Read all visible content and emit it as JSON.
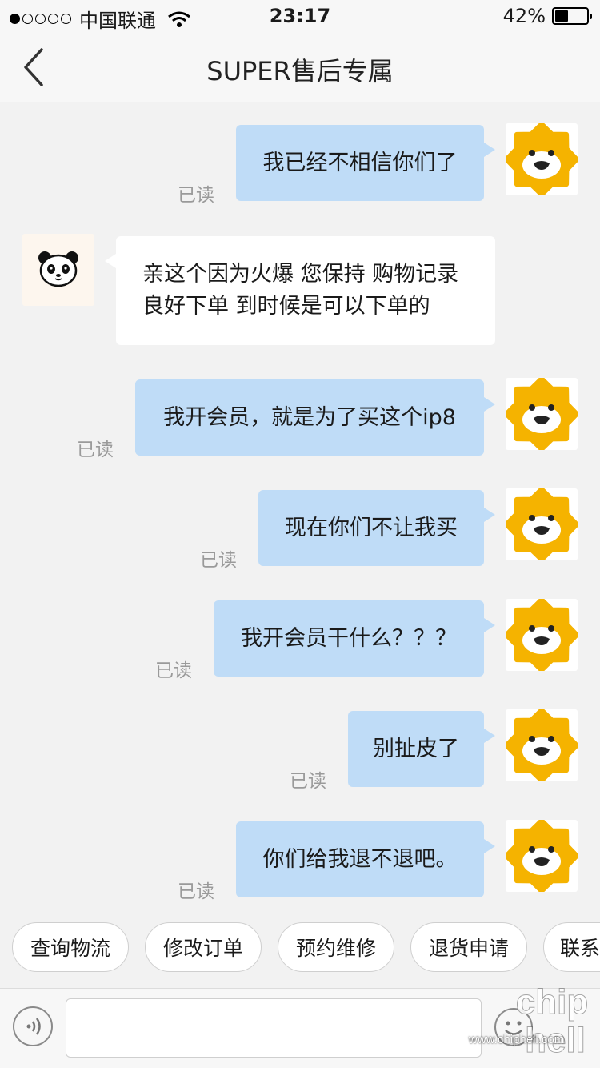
{
  "status_bar": {
    "carrier": "中国联通",
    "time": "23:17",
    "battery_percent": "42%",
    "battery_level": 0.42,
    "signal_dots_filled": 1,
    "signal_dots_total": 5
  },
  "nav": {
    "title": "SUPER售后专属",
    "back_icon": "chevron-left-icon"
  },
  "read_label": "已读",
  "messages": [
    {
      "direction": "out",
      "text": "我已经不相信你们了",
      "read": "已读"
    },
    {
      "direction": "in",
      "lines": [
        "亲这个因为火爆  您保持 购物记录",
        "良好下单 到时候是可以下单的"
      ]
    },
    {
      "direction": "out",
      "text": "我开会员，就是为了买这个ip8",
      "read": "已读"
    },
    {
      "direction": "out",
      "text": "现在你们不让我买",
      "read": "已读"
    },
    {
      "direction": "out",
      "text": "我开会员干什么？？？",
      "read": "已读"
    },
    {
      "direction": "out",
      "text": "别扯皮了",
      "read": "已读"
    },
    {
      "direction": "out",
      "text": "你们给我退不退吧。",
      "read": "已读"
    }
  ],
  "quick_replies": [
    "查询物流",
    "修改订单",
    "预约维修",
    "退货申请",
    "联系"
  ],
  "input_bar": {
    "voice_icon": "voice-icon",
    "emoji_icon": "emoji-icon",
    "input_value": ""
  },
  "watermark": {
    "logo_text": "chip hell",
    "url": "www.chiphell.com"
  },
  "colors": {
    "out_bubble": "#bfdcf7",
    "in_bubble": "#ffffff",
    "background": "#f2f2f2",
    "lion_orange": "#f5b300"
  }
}
